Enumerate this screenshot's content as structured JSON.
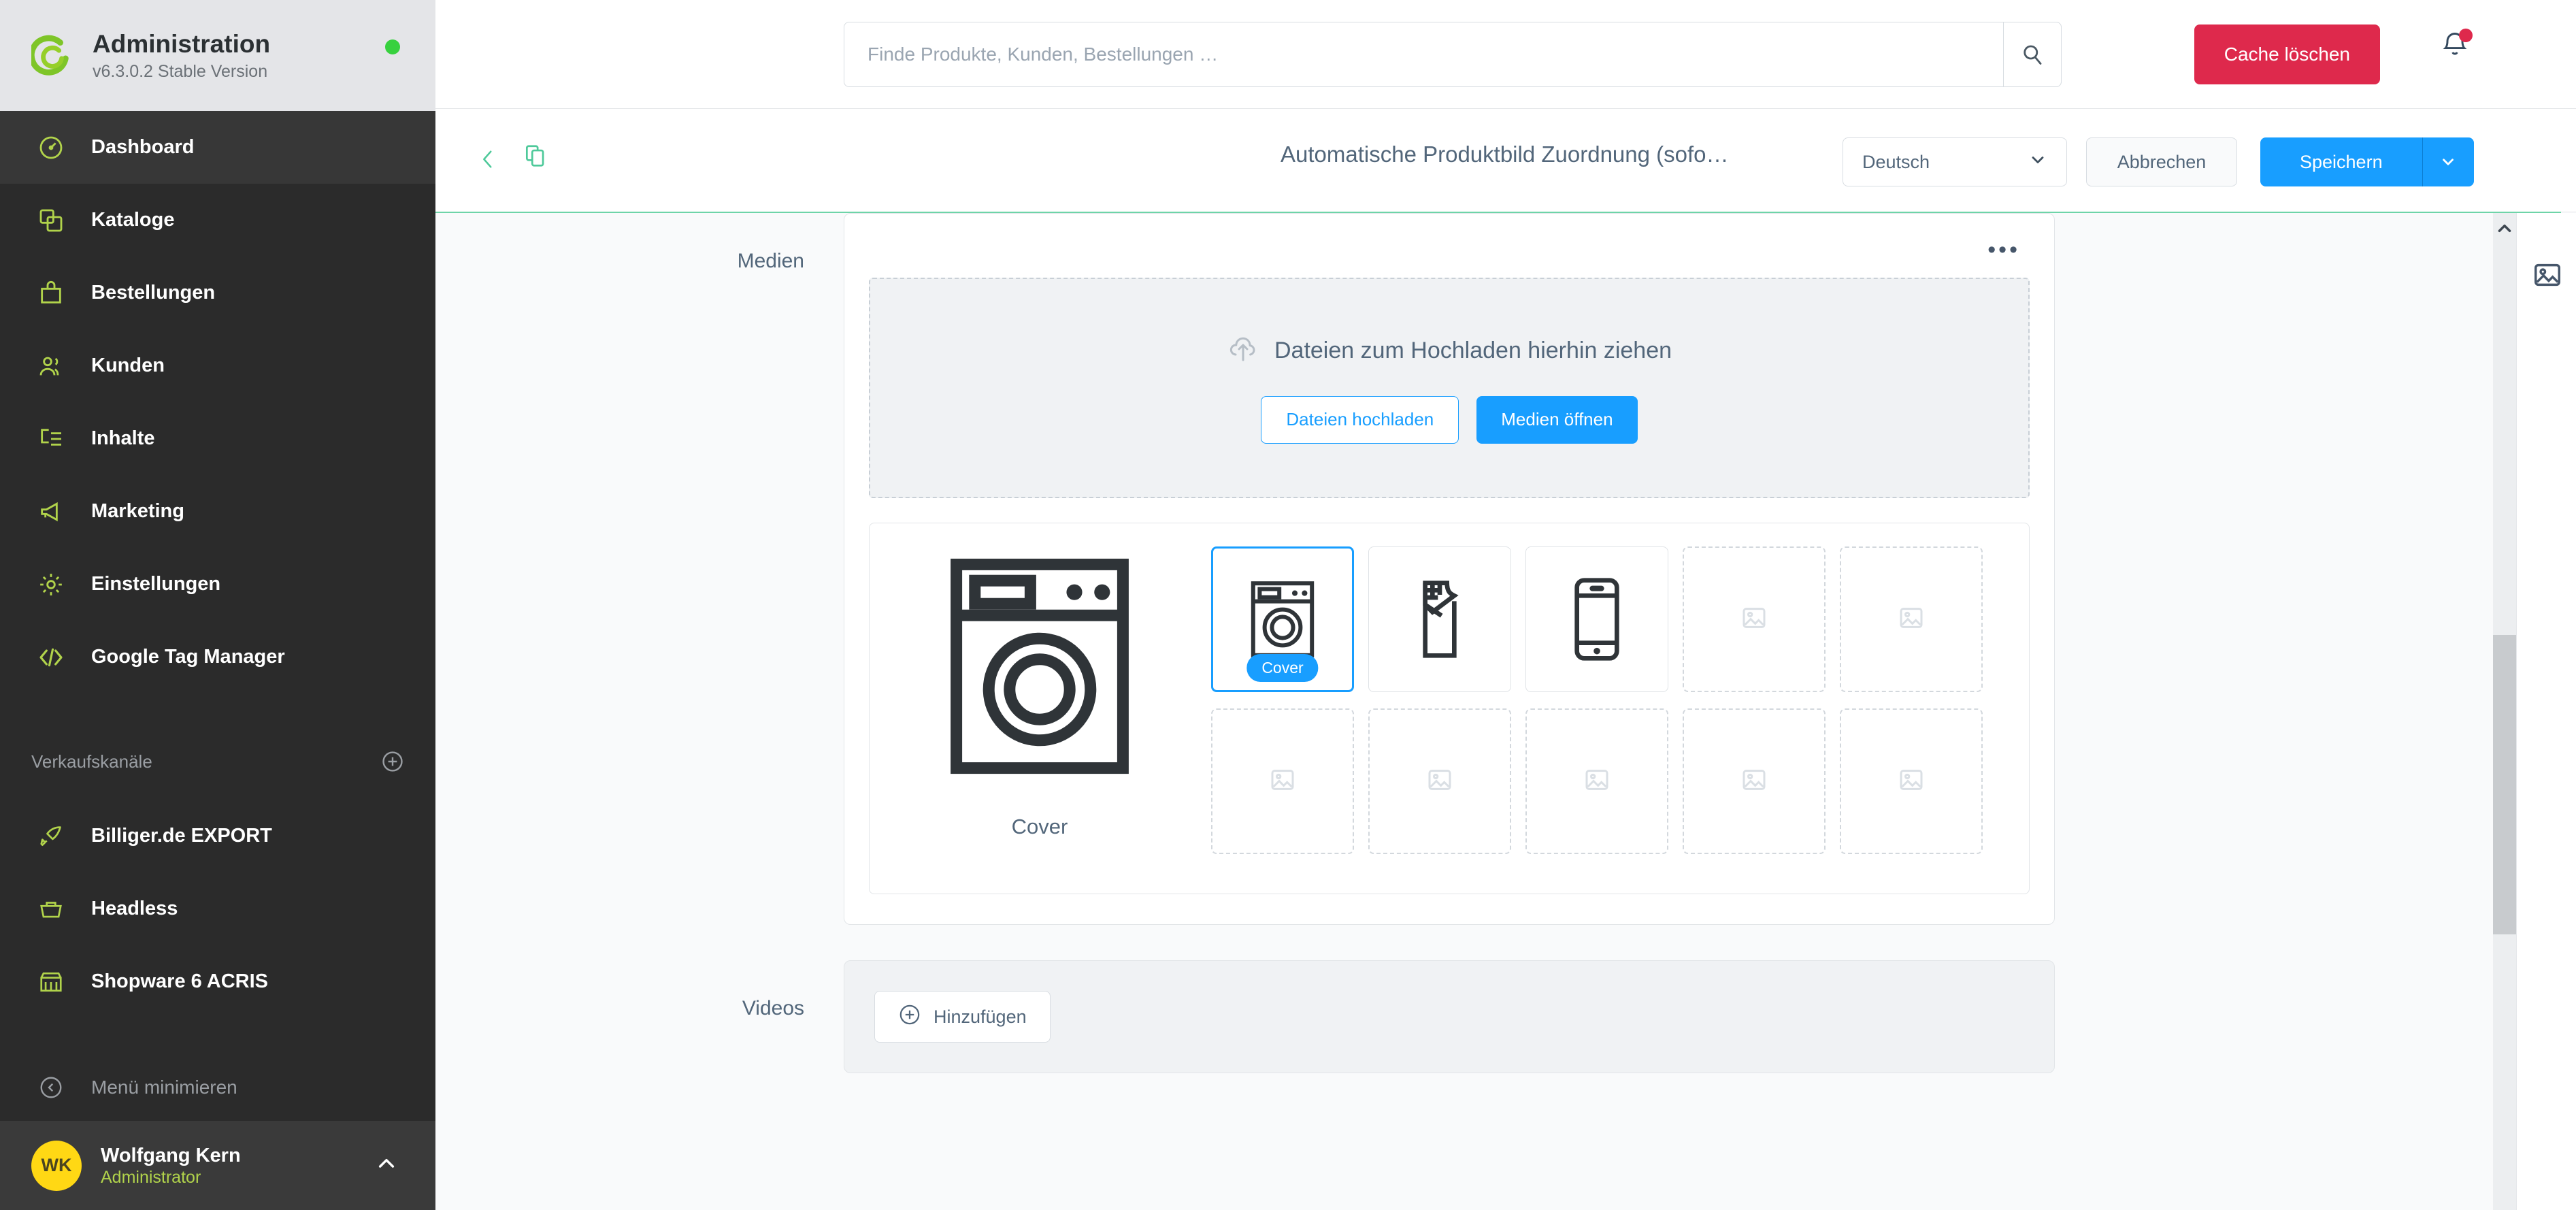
{
  "sidebar": {
    "brand": {
      "title": "Administration",
      "version": "v6.3.0.2 Stable Version"
    },
    "nav_items": [
      {
        "label": "Dashboard",
        "icon": "gauge-icon",
        "active": true
      },
      {
        "label": "Kataloge",
        "icon": "catalog-icon",
        "active": false
      },
      {
        "label": "Bestellungen",
        "icon": "bag-icon",
        "active": false
      },
      {
        "label": "Kunden",
        "icon": "users-icon",
        "active": false
      },
      {
        "label": "Inhalte",
        "icon": "content-icon",
        "active": false
      },
      {
        "label": "Marketing",
        "icon": "megaphone-icon",
        "active": false
      },
      {
        "label": "Einstellungen",
        "icon": "gear-icon",
        "active": false
      },
      {
        "label": "Google Tag Manager",
        "icon": "code-icon",
        "active": false
      }
    ],
    "sales_channels_title": "Verkaufskanäle",
    "sales_channels": [
      {
        "label": "Billiger.de EXPORT",
        "icon": "rocket-icon"
      },
      {
        "label": "Headless",
        "icon": "basket-icon"
      },
      {
        "label": "Shopware 6 ACRIS",
        "icon": "storefront-icon"
      }
    ],
    "minimize_label": "Menü minimieren",
    "user": {
      "initials": "WK",
      "name": "Wolfgang Kern",
      "role": "Administrator"
    }
  },
  "topbar": {
    "search_placeholder": "Finde Produkte, Kunden, Bestellungen …",
    "search_value": "",
    "cache_button": "Cache löschen"
  },
  "smartbar": {
    "title": "Automatische Produktbild Zuordnung (sofo…",
    "language": "Deutsch",
    "cancel_label": "Abbrechen",
    "save_label": "Speichern"
  },
  "main": {
    "media": {
      "section_label": "Medien",
      "dropzone_text": "Dateien zum Hochladen hierhin ziehen",
      "upload_button": "Dateien hochladen",
      "open_media_button": "Medien öffnen",
      "cover_caption": "Cover",
      "cover_badge": "Cover",
      "thumbnails": [
        {
          "kind": "washing-machine",
          "selected": true,
          "badge": "Cover"
        },
        {
          "kind": "chocolate-bar",
          "selected": false,
          "badge": ""
        },
        {
          "kind": "smartphone",
          "selected": false,
          "badge": ""
        },
        {
          "kind": "empty",
          "selected": false,
          "badge": ""
        },
        {
          "kind": "empty",
          "selected": false,
          "badge": ""
        },
        {
          "kind": "empty",
          "selected": false,
          "badge": ""
        },
        {
          "kind": "empty",
          "selected": false,
          "badge": ""
        },
        {
          "kind": "empty",
          "selected": false,
          "badge": ""
        },
        {
          "kind": "empty",
          "selected": false,
          "badge": ""
        },
        {
          "kind": "empty",
          "selected": false,
          "badge": ""
        }
      ]
    },
    "videos": {
      "section_label": "Videos",
      "add_button": "Hinzufügen"
    }
  },
  "colors": {
    "accent_blue": "#189eff",
    "danger_red": "#de294c",
    "brand_green": "#b1d34b",
    "mint_divider": "#6ed4a8",
    "avatar_yellow": "#ffd814",
    "sidebar_bg": "#2b2b2b"
  }
}
